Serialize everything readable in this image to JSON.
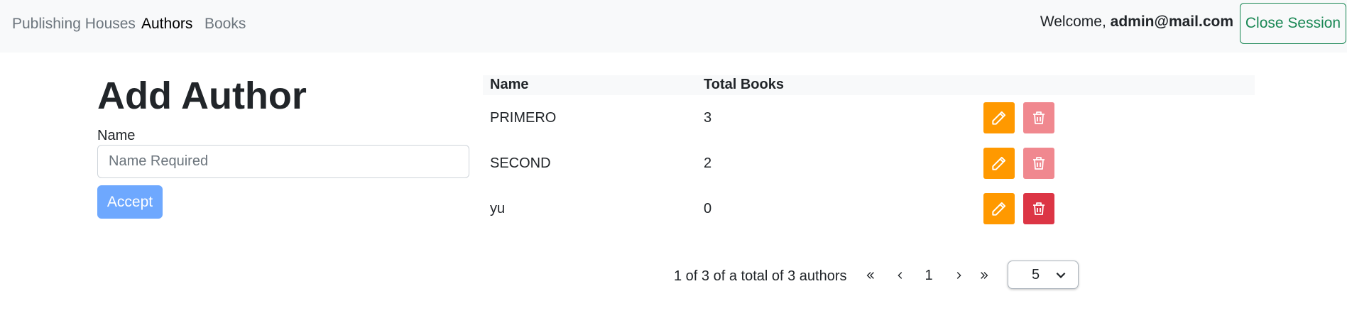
{
  "nav": {
    "links": [
      "Publishing Houses",
      "Authors",
      "Books"
    ],
    "welcome_prefix": "Welcome,",
    "user_email": "admin@mail.com",
    "close_session_label": "Close Session"
  },
  "form": {
    "title": "Add Author",
    "name_label": "Name",
    "name_placeholder": "Name Required",
    "name_value": "",
    "accept_label": "Accept"
  },
  "table": {
    "headers": [
      "Name",
      "Total Books"
    ],
    "rows": [
      {
        "name": "PRIMERO",
        "total_books": "3",
        "delete_enabled": false
      },
      {
        "name": "SECOND",
        "total_books": "2",
        "delete_enabled": false
      },
      {
        "name": "yu",
        "total_books": "0",
        "delete_enabled": true
      }
    ]
  },
  "pagination": {
    "info": "1 of 3 of a total of 3 authors",
    "first_label": "«",
    "prev_label": "‹",
    "current_page": "1",
    "next_label": "›",
    "last_label": "»",
    "page_size": "5"
  },
  "colors": {
    "edit": "#ff9900",
    "delete": "#dc3545",
    "delete_disabled": "#f0888f",
    "accept": "#6ea8fe",
    "close_session": "#198754"
  }
}
